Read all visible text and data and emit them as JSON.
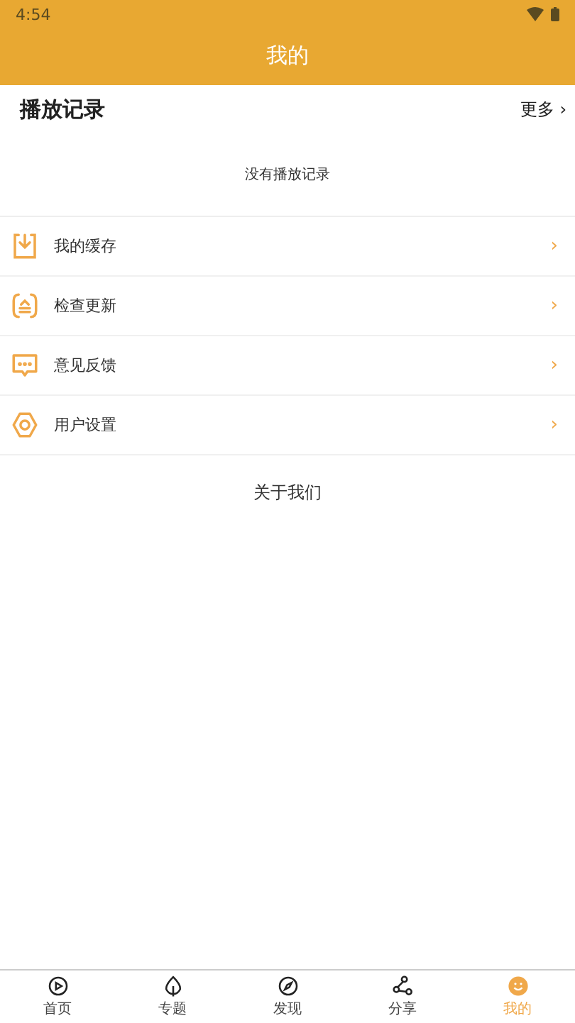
{
  "status_bar": {
    "time": "4:54"
  },
  "header": {
    "title": "我的"
  },
  "history": {
    "title": "播放记录",
    "more": "更多",
    "more_icon": "›",
    "empty": "没有播放记录"
  },
  "menu": [
    {
      "kind": "download",
      "label": "我的缓存",
      "arrow": "›"
    },
    {
      "kind": "update",
      "label": "检查更新",
      "arrow": "›"
    },
    {
      "kind": "feedback",
      "label": "意见反馈",
      "arrow": "›"
    },
    {
      "kind": "settings",
      "label": "用户设置",
      "arrow": "›"
    }
  ],
  "about": "关于我们",
  "tabs": [
    {
      "kind": "play",
      "label": "首页",
      "selected": false
    },
    {
      "kind": "leaf",
      "label": "专题",
      "selected": false
    },
    {
      "kind": "compass",
      "label": "发现",
      "selected": false
    },
    {
      "kind": "share",
      "label": "分享",
      "selected": false
    },
    {
      "kind": "smile",
      "label": "我的",
      "selected": true
    }
  ]
}
